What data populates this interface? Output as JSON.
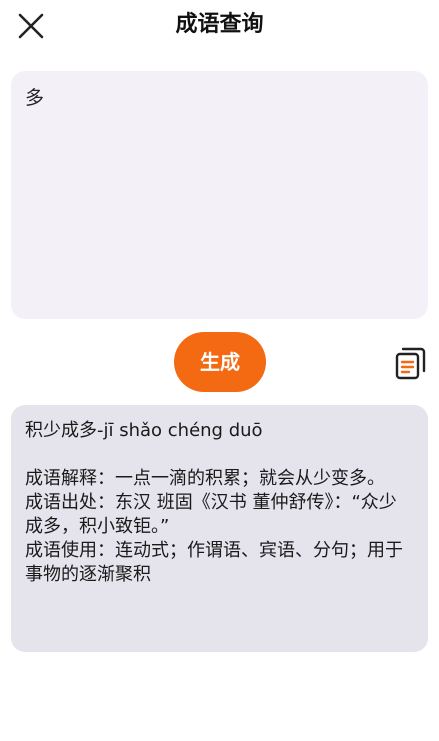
{
  "header": {
    "close_icon": "close-icon",
    "title": "成语查询"
  },
  "input": {
    "value": "多"
  },
  "actions": {
    "generate_label": "生成",
    "generate_color": "#f36a12",
    "copy_icon": "copy-icon"
  },
  "result": {
    "headline": "积少成多-jī shǎo chéng duō",
    "explanation": "成语解释：一点一滴的积累；就会从少变多。",
    "source": "成语出处：东汉 班固《汉书 董仲舒传》：“众少成多，积小致钜。”",
    "usage": "成语使用：连动式；作谓语、宾语、分句；用于事物的逐渐聚积"
  }
}
